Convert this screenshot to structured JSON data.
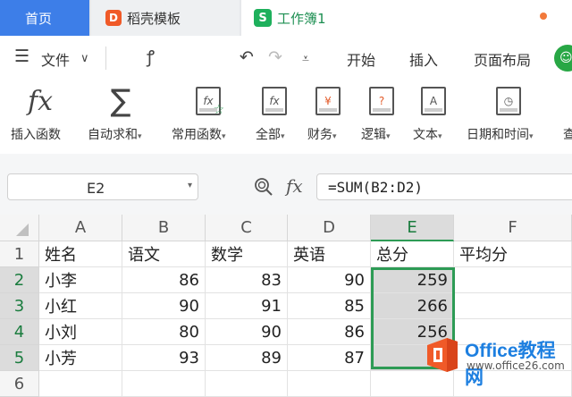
{
  "tabs": [
    {
      "label": "首页"
    },
    {
      "label": "稻壳模板"
    },
    {
      "label": "工作簿1"
    }
  ],
  "menu": {
    "file_label": "文件",
    "items": [
      "开始",
      "插入",
      "页面布局"
    ]
  },
  "ribbon": {
    "buttons": [
      {
        "label": "插入函数"
      },
      {
        "label": "自动求和"
      },
      {
        "label": "常用函数"
      },
      {
        "label": "全部"
      },
      {
        "label": "财务"
      },
      {
        "label": "逻辑"
      },
      {
        "label": "文本"
      },
      {
        "label": "日期和时间"
      },
      {
        "label": "查"
      }
    ]
  },
  "formula_bar": {
    "name_box": "E2",
    "formula": "=SUM(B2:D2)"
  },
  "sheet": {
    "columns": [
      "A",
      "B",
      "C",
      "D",
      "E",
      "F"
    ],
    "rows": [
      "1",
      "2",
      "3",
      "4",
      "5",
      "6"
    ],
    "cells": [
      [
        "姓名",
        "语文",
        "数学",
        "英语",
        "总分",
        "平均分"
      ],
      [
        "小李",
        "86",
        "83",
        "90",
        "259",
        ""
      ],
      [
        "小红",
        "90",
        "91",
        "85",
        "266",
        ""
      ],
      [
        "小刘",
        "80",
        "90",
        "86",
        "256",
        ""
      ],
      [
        "小芳",
        "93",
        "89",
        "87",
        "2",
        ""
      ]
    ]
  },
  "watermark": {
    "title": "Office教程网",
    "url": "www.office26.com"
  },
  "colors": {
    "accent_blue": "#3d7ee8",
    "sheet_green": "#2d9b55",
    "watermark_orange": "#f05a28"
  }
}
